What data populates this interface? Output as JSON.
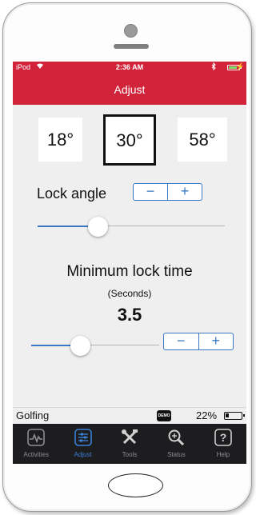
{
  "status_bar": {
    "carrier": "iPod",
    "time": "2:36 AM"
  },
  "nav": {
    "title": "Adjust"
  },
  "angles": {
    "left": "18°",
    "selected": "30°",
    "right": "58°"
  },
  "lock_angle": {
    "label": "Lock angle",
    "minus": "−",
    "plus": "+",
    "slider_fraction": 0.32
  },
  "min_lock_time": {
    "title": "Minimum lock time",
    "unit": "(Seconds)",
    "value": "3.5",
    "minus": "−",
    "plus": "+",
    "slider_fraction": 0.38
  },
  "device_status": {
    "mode": "Golfing",
    "demo_badge": "DEMO",
    "battery": "22%"
  },
  "tabs": [
    {
      "label": "Activities",
      "icon": "activity-chart-icon",
      "active": false
    },
    {
      "label": "Adjust",
      "icon": "sliders-icon",
      "active": true
    },
    {
      "label": "Tools",
      "icon": "tools-icon",
      "active": false
    },
    {
      "label": "Status",
      "icon": "magnifier-icon",
      "active": false
    },
    {
      "label": "Help",
      "icon": "question-icon",
      "active": false
    }
  ],
  "colors": {
    "header_red": "#d1233a",
    "accent_blue": "#3a78c4",
    "tabbar_bg": "#1d1d1f"
  }
}
